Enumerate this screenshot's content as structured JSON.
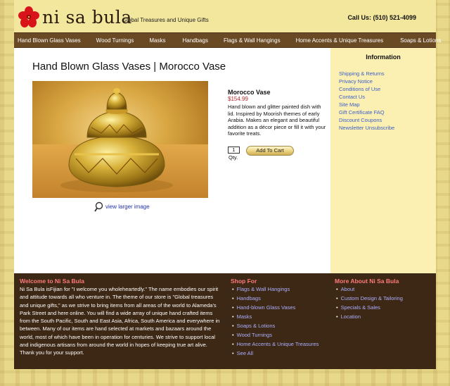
{
  "brand": {
    "name": "ni sa bula",
    "tagline": "Global Treasures and Unique Gifts",
    "phone": "Call  Us: (510) 521-4099"
  },
  "nav": [
    "Hand Blown Glass Vases",
    "Wood Turnings",
    "Masks",
    "Handbags",
    "Flags & Wall Hangings",
    "Home Accents & Unique Treasures",
    "Soaps & Lotions"
  ],
  "product": {
    "page_title": "Hand Blown Glass Vases | Morocco Vase",
    "name": "Morocco Vase",
    "price": "$154.99",
    "description": "Hand blown and glitter painted dish with lid. Inspired by Moorish themes of early Arabia.  Makes an elegant and beautiful addition as a décor piece or fill it with your favorite treats.",
    "qty_value": "1",
    "qty_label": "Qty.",
    "add_to_cart": "Add To Cart",
    "view_larger": "view larger image"
  },
  "sidebar": {
    "title": "Information",
    "links": [
      "Shipping & Returns",
      "Privacy Notice",
      "Conditions of Use",
      "Contact Us",
      "Site Map",
      "Gift Certificate FAQ",
      "Discount Coupons",
      "Newsletter Unsubscribe"
    ]
  },
  "footer": {
    "welcome_title": "Welcome to Ni Sa Bula",
    "welcome_text": "Ni Sa Bula isFijian for \"I welcome you wholeheartedly.\" The name embodies our spirit and attitude towards all who venture in. The theme of our store is \"Global treasures and unique gifts,\" as we strive to bring items from all areas of the world to Alameda's Park Street and here online. You will find a wide array of unique hand crafted items from the South Pacific, South and East Asia, Africa, South America and everywhere in between. Many of our items are hand selected at markets and bazaars around the world, most of which have been in operation for centuries. We strive to support local and indigenous artisans from around the world in hopes of keeping true art alive. Thank you for your support.",
    "shop_title": "Shop For",
    "shop_links": [
      "Flags & Wall Hangings",
      "Handbags",
      "Hand-blown Glass Vases",
      "Masks",
      "Soaps & Lotions",
      "Wood Turnings",
      "Home Accents & Unique Treasures",
      "See All"
    ],
    "about_title": "More About Ni Sa Bula",
    "about_links": [
      "About",
      "Custom Design & Tailoring",
      "Specials & Sales",
      "Location"
    ]
  },
  "colors": {
    "nav_bg": "#6a4a24",
    "footer_bg": "#3d2715",
    "footer_heading": "#ff7b7b",
    "link_blue": "#3a5fc8",
    "price_red": "#b22a2a"
  }
}
